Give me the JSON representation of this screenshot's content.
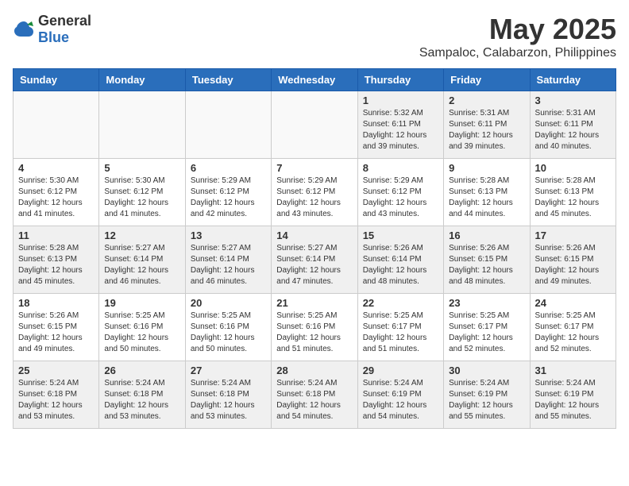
{
  "logo": {
    "general": "General",
    "blue": "Blue"
  },
  "title": "May 2025",
  "location": "Sampaloc, Calabarzon, Philippines",
  "days_of_week": [
    "Sunday",
    "Monday",
    "Tuesday",
    "Wednesday",
    "Thursday",
    "Friday",
    "Saturday"
  ],
  "weeks": [
    [
      {
        "day": "",
        "info": ""
      },
      {
        "day": "",
        "info": ""
      },
      {
        "day": "",
        "info": ""
      },
      {
        "day": "",
        "info": ""
      },
      {
        "day": "1",
        "info": "Sunrise: 5:32 AM\nSunset: 6:11 PM\nDaylight: 12 hours\nand 39 minutes."
      },
      {
        "day": "2",
        "info": "Sunrise: 5:31 AM\nSunset: 6:11 PM\nDaylight: 12 hours\nand 39 minutes."
      },
      {
        "day": "3",
        "info": "Sunrise: 5:31 AM\nSunset: 6:11 PM\nDaylight: 12 hours\nand 40 minutes."
      }
    ],
    [
      {
        "day": "4",
        "info": "Sunrise: 5:30 AM\nSunset: 6:12 PM\nDaylight: 12 hours\nand 41 minutes."
      },
      {
        "day": "5",
        "info": "Sunrise: 5:30 AM\nSunset: 6:12 PM\nDaylight: 12 hours\nand 41 minutes."
      },
      {
        "day": "6",
        "info": "Sunrise: 5:29 AM\nSunset: 6:12 PM\nDaylight: 12 hours\nand 42 minutes."
      },
      {
        "day": "7",
        "info": "Sunrise: 5:29 AM\nSunset: 6:12 PM\nDaylight: 12 hours\nand 43 minutes."
      },
      {
        "day": "8",
        "info": "Sunrise: 5:29 AM\nSunset: 6:12 PM\nDaylight: 12 hours\nand 43 minutes."
      },
      {
        "day": "9",
        "info": "Sunrise: 5:28 AM\nSunset: 6:13 PM\nDaylight: 12 hours\nand 44 minutes."
      },
      {
        "day": "10",
        "info": "Sunrise: 5:28 AM\nSunset: 6:13 PM\nDaylight: 12 hours\nand 45 minutes."
      }
    ],
    [
      {
        "day": "11",
        "info": "Sunrise: 5:28 AM\nSunset: 6:13 PM\nDaylight: 12 hours\nand 45 minutes."
      },
      {
        "day": "12",
        "info": "Sunrise: 5:27 AM\nSunset: 6:14 PM\nDaylight: 12 hours\nand 46 minutes."
      },
      {
        "day": "13",
        "info": "Sunrise: 5:27 AM\nSunset: 6:14 PM\nDaylight: 12 hours\nand 46 minutes."
      },
      {
        "day": "14",
        "info": "Sunrise: 5:27 AM\nSunset: 6:14 PM\nDaylight: 12 hours\nand 47 minutes."
      },
      {
        "day": "15",
        "info": "Sunrise: 5:26 AM\nSunset: 6:14 PM\nDaylight: 12 hours\nand 48 minutes."
      },
      {
        "day": "16",
        "info": "Sunrise: 5:26 AM\nSunset: 6:15 PM\nDaylight: 12 hours\nand 48 minutes."
      },
      {
        "day": "17",
        "info": "Sunrise: 5:26 AM\nSunset: 6:15 PM\nDaylight: 12 hours\nand 49 minutes."
      }
    ],
    [
      {
        "day": "18",
        "info": "Sunrise: 5:26 AM\nSunset: 6:15 PM\nDaylight: 12 hours\nand 49 minutes."
      },
      {
        "day": "19",
        "info": "Sunrise: 5:25 AM\nSunset: 6:16 PM\nDaylight: 12 hours\nand 50 minutes."
      },
      {
        "day": "20",
        "info": "Sunrise: 5:25 AM\nSunset: 6:16 PM\nDaylight: 12 hours\nand 50 minutes."
      },
      {
        "day": "21",
        "info": "Sunrise: 5:25 AM\nSunset: 6:16 PM\nDaylight: 12 hours\nand 51 minutes."
      },
      {
        "day": "22",
        "info": "Sunrise: 5:25 AM\nSunset: 6:17 PM\nDaylight: 12 hours\nand 51 minutes."
      },
      {
        "day": "23",
        "info": "Sunrise: 5:25 AM\nSunset: 6:17 PM\nDaylight: 12 hours\nand 52 minutes."
      },
      {
        "day": "24",
        "info": "Sunrise: 5:25 AM\nSunset: 6:17 PM\nDaylight: 12 hours\nand 52 minutes."
      }
    ],
    [
      {
        "day": "25",
        "info": "Sunrise: 5:24 AM\nSunset: 6:18 PM\nDaylight: 12 hours\nand 53 minutes."
      },
      {
        "day": "26",
        "info": "Sunrise: 5:24 AM\nSunset: 6:18 PM\nDaylight: 12 hours\nand 53 minutes."
      },
      {
        "day": "27",
        "info": "Sunrise: 5:24 AM\nSunset: 6:18 PM\nDaylight: 12 hours\nand 53 minutes."
      },
      {
        "day": "28",
        "info": "Sunrise: 5:24 AM\nSunset: 6:18 PM\nDaylight: 12 hours\nand 54 minutes."
      },
      {
        "day": "29",
        "info": "Sunrise: 5:24 AM\nSunset: 6:19 PM\nDaylight: 12 hours\nand 54 minutes."
      },
      {
        "day": "30",
        "info": "Sunrise: 5:24 AM\nSunset: 6:19 PM\nDaylight: 12 hours\nand 55 minutes."
      },
      {
        "day": "31",
        "info": "Sunrise: 5:24 AM\nSunset: 6:19 PM\nDaylight: 12 hours\nand 55 minutes."
      }
    ]
  ]
}
